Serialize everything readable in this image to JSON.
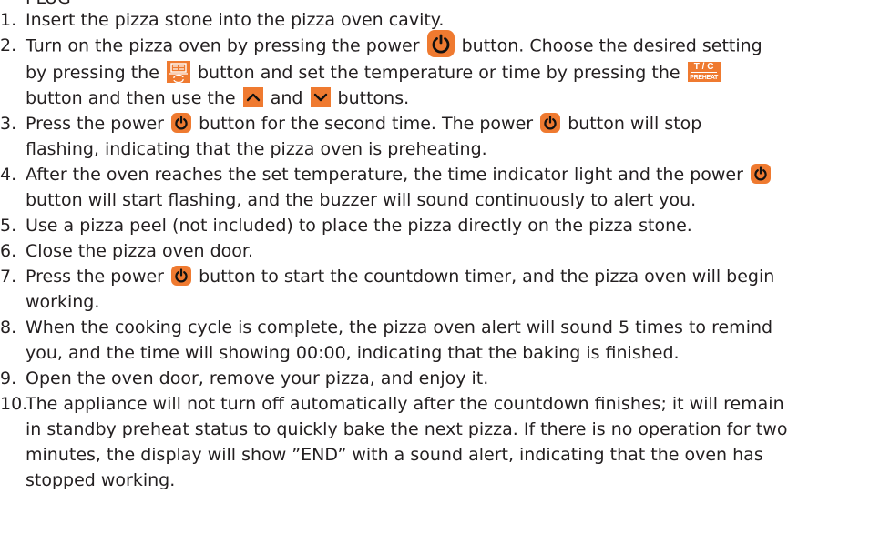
{
  "colors": {
    "accent": "#ef7a30",
    "text": "#231f20"
  },
  "icons": {
    "power": "power-icon",
    "menu": "menu-icon",
    "tc_preheat": "tc-preheat-icon",
    "up": "chevron-up-icon",
    "down": "chevron-down-icon",
    "tc_top_text": "T / C",
    "tc_bottom_text": "PREHEAT"
  },
  "cut_line": "PLUG",
  "steps": [
    {
      "num": "1.",
      "text": "Insert the pizza stone into the pizza oven cavity."
    },
    {
      "num": "2.",
      "a": "Turn on the pizza oven by pressing the power",
      "b": "button. Choose the desired setting",
      "c": "by pressing the",
      "d": "button and set the temperature or time by pressing the",
      "e": "button and then use the",
      "f": "and",
      "g": "buttons."
    },
    {
      "num": "3.",
      "a": "Press the power",
      "b": "button for the second time. The power",
      "c": "button will stop",
      "d": "flashing, indicating that the pizza oven is preheating."
    },
    {
      "num": "4.",
      "a": "After the oven reaches the set temperature, the time indicator light and the power",
      "b": "button will start flashing, and the buzzer will sound continuously to alert you."
    },
    {
      "num": "5.",
      "text": "Use a pizza peel (not included) to place the pizza directly on the pizza stone."
    },
    {
      "num": "6.",
      "text": "Close the pizza oven door."
    },
    {
      "num": "7.",
      "a": "Press the power",
      "b": "button to start the countdown timer, and the pizza oven will begin",
      "c": "working."
    },
    {
      "num": "8.",
      "a": "When the cooking cycle is complete, the pizza oven alert will sound 5 times to remind",
      "b": "you, and the time will showing 00:00, indicating that the baking is finished."
    },
    {
      "num": "9.",
      "text": "Open the oven door, remove your pizza, and enjoy it."
    },
    {
      "num": "10.",
      "a": "The appliance will not turn off automatically after the countdown finishes; it will remain",
      "b": "in standby preheat status to quickly bake the next pizza. If there is no operation for two",
      "c": "minutes, the display will show ”END” with a sound alert, indicating that the oven has",
      "d": "stopped working."
    }
  ]
}
